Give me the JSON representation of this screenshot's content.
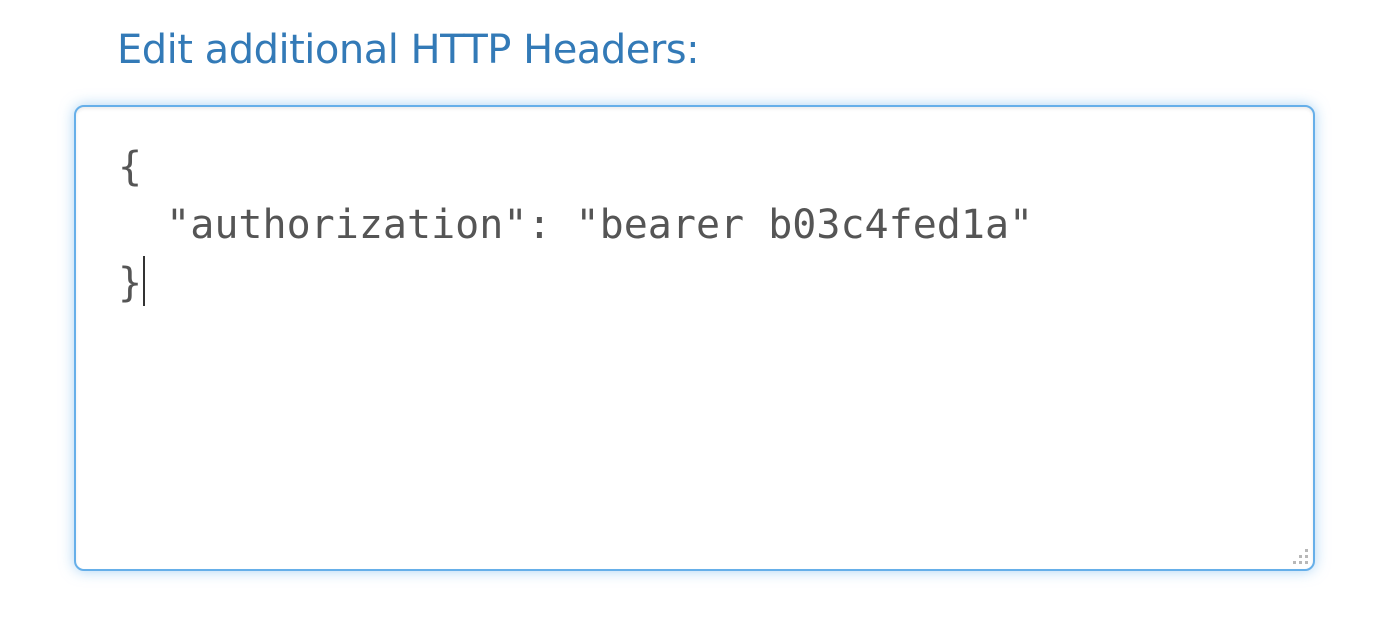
{
  "form": {
    "heading": "Edit additional HTTP Headers:"
  },
  "headers_editor": {
    "lines": [
      "{",
      "  \"authorization\": \"bearer b03c4fed1a\"",
      "}"
    ],
    "focused": true,
    "border_color": "#66afe9",
    "text_color": "#555555"
  },
  "colors": {
    "heading": "#337ab7"
  },
  "icons": {
    "resize": "resize-grip-icon"
  }
}
